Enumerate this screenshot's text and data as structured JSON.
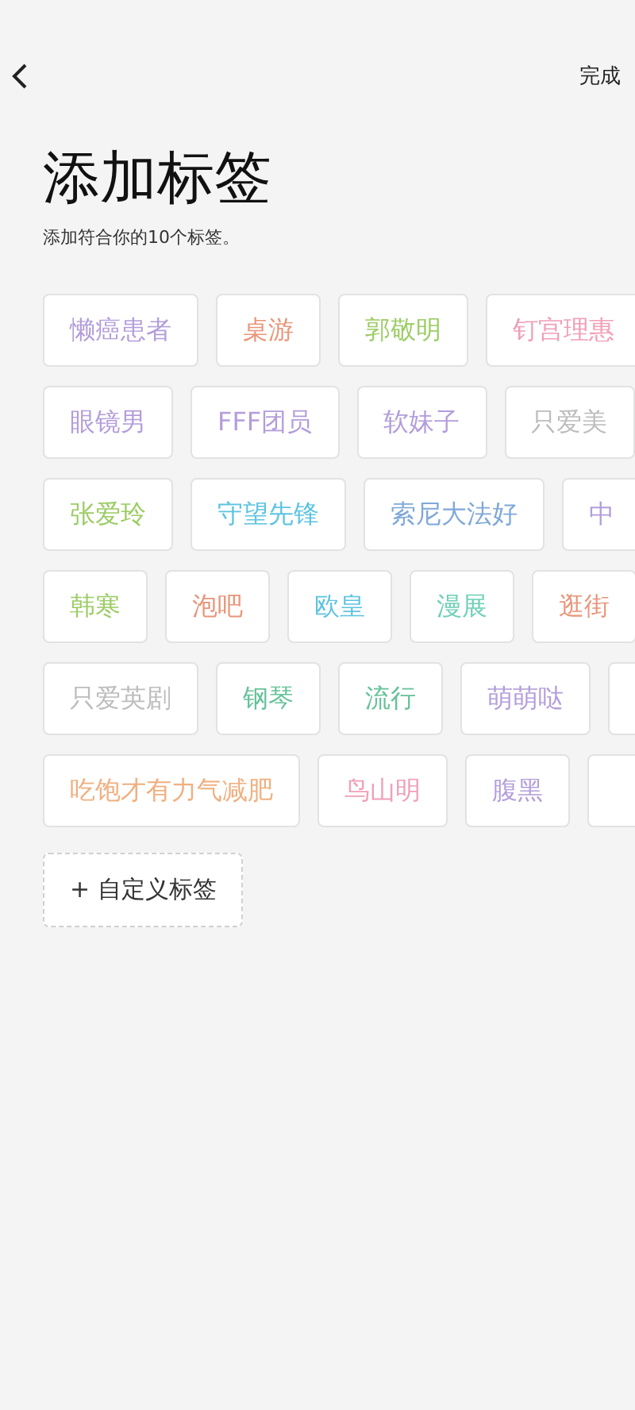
{
  "header": {
    "done": "完成"
  },
  "title": "添加标签",
  "subtitle": "添加符合你的10个标签。",
  "tag_rows": [
    [
      {
        "label": "懒癌患者",
        "color": "#b39ddb"
      },
      {
        "label": "桌游",
        "color": "#e8967a"
      },
      {
        "label": "郭敬明",
        "color": "#9ccc65"
      },
      {
        "label": "钉宫理惠",
        "color": "#f0a0b8"
      }
    ],
    [
      {
        "label": "眼镜男",
        "color": "#b39ddb"
      },
      {
        "label": "FFF团员",
        "color": "#b39ddb"
      },
      {
        "label": "软妹子",
        "color": "#b39ddb"
      },
      {
        "label": "只爱美",
        "color": "#bdbdbd"
      }
    ],
    [
      {
        "label": "张爱玲",
        "color": "#9ccc65"
      },
      {
        "label": "守望先锋",
        "color": "#5ec4e0"
      },
      {
        "label": "索尼大法好",
        "color": "#7fa8d8"
      },
      {
        "label": "中",
        "color": "#b39ddb"
      }
    ],
    [
      {
        "label": "韩寒",
        "color": "#9ccc65"
      },
      {
        "label": "泡吧",
        "color": "#e8967a"
      },
      {
        "label": "欧皇",
        "color": "#5ec4e0"
      },
      {
        "label": "漫展",
        "color": "#6fd0b8"
      },
      {
        "label": "逛街",
        "color": "#e8967a"
      }
    ],
    [
      {
        "label": "只爱英剧",
        "color": "#bdbdbd"
      },
      {
        "label": "钢琴",
        "color": "#66c29a"
      },
      {
        "label": "流行",
        "color": "#66c29a"
      },
      {
        "label": "萌萌哒",
        "color": "#b39ddb"
      },
      {}
    ],
    [
      {
        "label": "吃饱才有力气减肥",
        "color": "#f0b080"
      },
      {
        "label": "鸟山明",
        "color": "#f0a0b8"
      },
      {
        "label": "腹黑",
        "color": "#b39ddb"
      },
      {}
    ]
  ],
  "custom_button": "+ 自定义标签"
}
